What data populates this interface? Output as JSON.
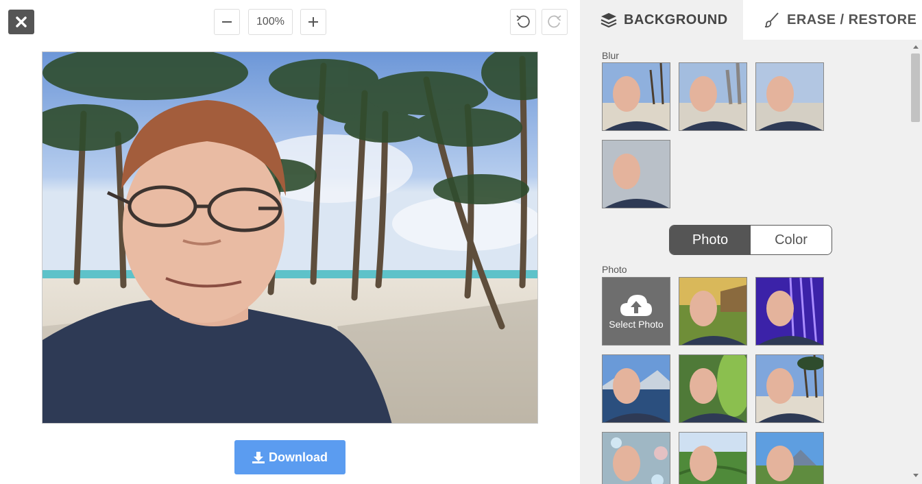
{
  "toolbar": {
    "zoom_value": "100%",
    "close_icon": "close-icon",
    "zoom_out_icon": "minus-icon",
    "zoom_in_icon": "plus-icon",
    "undo_icon": "undo-icon",
    "redo_icon": "redo-icon"
  },
  "download": {
    "label": "Download",
    "icon": "download-icon"
  },
  "tabs": [
    {
      "label": "BACKGROUND",
      "icon": "layers-icon"
    },
    {
      "label": "ERASE / RESTORE",
      "icon": "brush-icon"
    }
  ],
  "blur_section": {
    "label": "Blur"
  },
  "mode_toggle": {
    "photo_label": "Photo",
    "color_label": "Color",
    "selected": "Photo"
  },
  "photo_section": {
    "label": "Photo",
    "select_photo_label": "Select Photo",
    "upload_icon": "cloud-upload-icon"
  },
  "colors": {
    "accent": "#5b9cf0",
    "panel_bg": "#f0f0f0",
    "dark_button": "#555555"
  }
}
